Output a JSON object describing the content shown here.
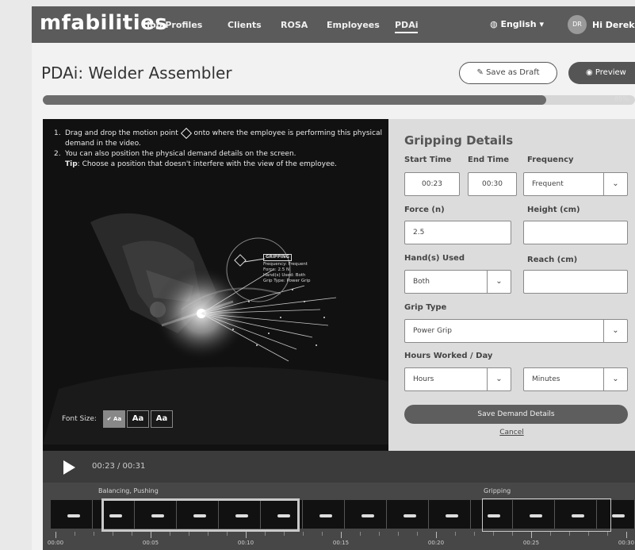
{
  "app": {
    "brand": "mfabilities"
  },
  "nav": {
    "items": [
      "Job Profiles",
      "Clients",
      "ROSA",
      "Employees",
      "PDAi"
    ],
    "active": "PDAi",
    "language": "English",
    "avatar_initials": "DR",
    "greeting": "Hi Derek"
  },
  "header": {
    "title": "PDAi: Welder Assembler",
    "save_draft_label": "Save as Draft",
    "preview_label": "Preview"
  },
  "progress": {
    "percent": 85,
    "label": "85%"
  },
  "video": {
    "instructions": [
      {
        "num": "1.",
        "before": "Drag and drop the motion point",
        "after": "onto where the employee is performing this physical demand in the video."
      },
      {
        "num": "2.",
        "text": "You can also position the physical demand details on the screen."
      }
    ],
    "tip_label": "Tip",
    "tip_text": ": Choose a position that doesn't interfere with the view of the employee.",
    "popup": {
      "title": "GRIPPING",
      "lines": [
        "Frequency: Frequent",
        "Force: 2.5 N",
        "Hand(s) Used: Both",
        "Grip Type: Power Grip"
      ]
    },
    "font_size_label": "Font Size:",
    "font_size_options": [
      "✔ Aa",
      "Aa",
      "Aa"
    ],
    "font_size_selected": 0
  },
  "details": {
    "title": "Gripping Details",
    "start_time_label": "Start Time",
    "start_time_value": "00:23",
    "end_time_label": "End Time",
    "end_time_value": "00:30",
    "frequency_label": "Frequency",
    "frequency_value": "Frequent",
    "force_label": "Force (n)",
    "force_value": "2.5",
    "height_label": "Height (cm)",
    "height_value": "",
    "hands_label": "Hand(s) Used",
    "hands_value": "Both",
    "reach_label": "Reach (cm)",
    "reach_value": "",
    "grip_type_label": "Grip Type",
    "grip_type_value": "Power Grip",
    "hours_label": "Hours Worked / Day",
    "hours_placeholder": "Hours",
    "minutes_placeholder": "Minutes",
    "save_label": "Save Demand Details",
    "cancel_label": "Cancel"
  },
  "player": {
    "time": "00:23 / 00:31"
  },
  "timeline": {
    "segments": [
      {
        "label": "Balancing, Pushing"
      },
      {
        "label": "Gripping"
      }
    ],
    "tick_labels": [
      "00:00",
      "00:05",
      "00:10",
      "00:15",
      "00:20",
      "00:25",
      "00:30"
    ]
  },
  "colors": {
    "nav_bg": "#5b5b5b",
    "button_dark": "#555555",
    "panel_bg": "#dcdcdc",
    "video_bg": "#111111"
  }
}
